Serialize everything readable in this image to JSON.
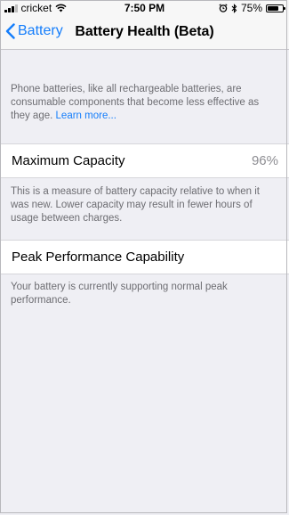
{
  "status_bar": {
    "carrier": "cricket",
    "time": "7:50 PM",
    "battery_percent": "75%",
    "battery_level": 0.75,
    "icons": [
      "signal-icon",
      "wifi-icon",
      "alarm-icon",
      "bluetooth-icon",
      "battery-icon"
    ]
  },
  "nav": {
    "back_label": "Battery",
    "title": "Battery Health (Beta)"
  },
  "intro": {
    "text": "Phone batteries, like all rechargeable batteries, are consumable components that become less effective as they age.",
    "link": "Learn more..."
  },
  "max_capacity": {
    "label": "Maximum Capacity",
    "value": "96%",
    "footer": "This is a measure of battery capacity relative to when it was new. Lower capacity may result in fewer hours of usage between charges."
  },
  "peak_performance": {
    "label": "Peak Performance Capability",
    "footer": "Your battery is currently supporting normal peak performance."
  },
  "colors": {
    "accent": "#157efb",
    "background": "#efeff4",
    "secondary_text": "#6d6d72"
  }
}
